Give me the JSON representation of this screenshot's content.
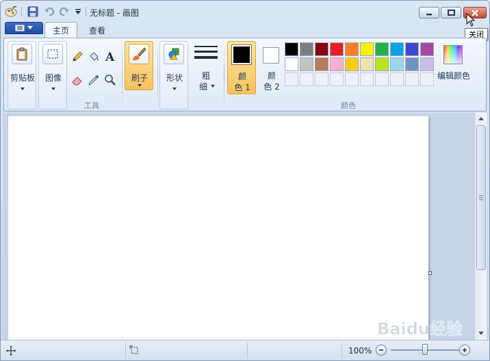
{
  "window": {
    "title": "无标题 - 画图",
    "controls": {
      "close_tooltip": "关闭"
    }
  },
  "quick_access": [
    "paint-app-icon",
    "save-icon",
    "undo-icon",
    "redo-icon",
    "customize-icon"
  ],
  "tabs": [
    {
      "label": "主页",
      "active": true
    },
    {
      "label": "查看",
      "active": false
    }
  ],
  "ribbon": {
    "clipboard": {
      "label": "剪贴板"
    },
    "image": {
      "label": "图像"
    },
    "tools": {
      "group_label": "工具",
      "items": [
        "pencil-icon",
        "fill-icon",
        "text-icon",
        "eraser-icon",
        "color-picker-icon",
        "magnifier-icon"
      ]
    },
    "brushes": {
      "label": "刷子",
      "selected": true
    },
    "shapes": {
      "label": "形状"
    },
    "size": {
      "label_line1": "粗",
      "label_line2": "细"
    },
    "color1": {
      "label_line1": "颜",
      "label_line2": "色 1",
      "value": "#000000",
      "selected": true
    },
    "color2": {
      "label_line1": "颜",
      "label_line2": "色 2",
      "value": "#ffffff"
    },
    "colors_group_label": "颜色",
    "edit_colors": {
      "label": "编辑颜色"
    },
    "palette_row1": [
      "#000000",
      "#7f7f7f",
      "#880015",
      "#ed1c24",
      "#ff7f27",
      "#fff200",
      "#22b14c",
      "#00a2e8",
      "#3f48cc",
      "#a349a4"
    ],
    "palette_row2": [
      "#ffffff",
      "#c3c3c3",
      "#b97a57",
      "#ffaec9",
      "#ffc90e",
      "#efe4b0",
      "#b5e61d",
      "#99d9ea",
      "#7092be",
      "#c8bfe7"
    ],
    "palette_row3_count": 10
  },
  "status": {
    "zoom": "100%",
    "zoom_level": 0.5
  },
  "watermark": "Baidu经验"
}
